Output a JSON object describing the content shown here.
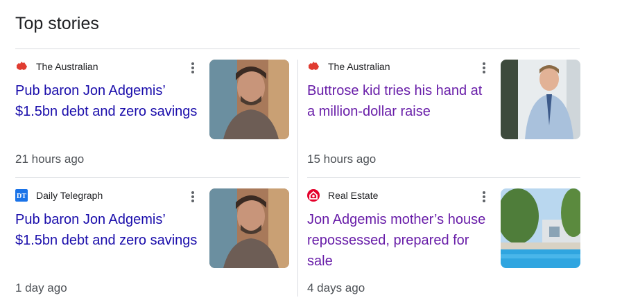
{
  "section": {
    "title": "Top stories"
  },
  "stories": [
    {
      "source": "The Australian",
      "source_icon": "australia-map-icon",
      "headline": "Pub baron Jon Adgemis’ $1.5bn debt and zero savings",
      "time": "21 hours ago",
      "image": "man-portrait-thumbnail",
      "link_state": "unvisited"
    },
    {
      "source": "The Australian",
      "source_icon": "australia-map-icon",
      "headline": "Buttrose kid tries his hand at a million-dollar raise",
      "time": "15 hours ago",
      "image": "man-in-shirt-thumbnail",
      "link_state": "visited"
    },
    {
      "source": "Daily Telegraph",
      "source_icon": "dt-logo-icon",
      "headline": "Pub baron Jon Adgemis’ $1.5bn debt and zero savings",
      "time": "1 day ago",
      "image": "man-portrait-thumbnail",
      "link_state": "unvisited"
    },
    {
      "source": "Real Estate",
      "source_icon": "house-logo-icon",
      "headline": "Jon Adgemis mother’s house repossessed, prepared for sale",
      "time": "4 days ago",
      "image": "pool-house-thumbnail",
      "link_state": "visited"
    }
  ],
  "colors": {
    "unvisited_link": "#1a0dab",
    "visited_link": "#681da8",
    "australian_brand": "#e03c31",
    "dt_brand": "#1a73e8",
    "realestate_brand": "#e4002b"
  }
}
